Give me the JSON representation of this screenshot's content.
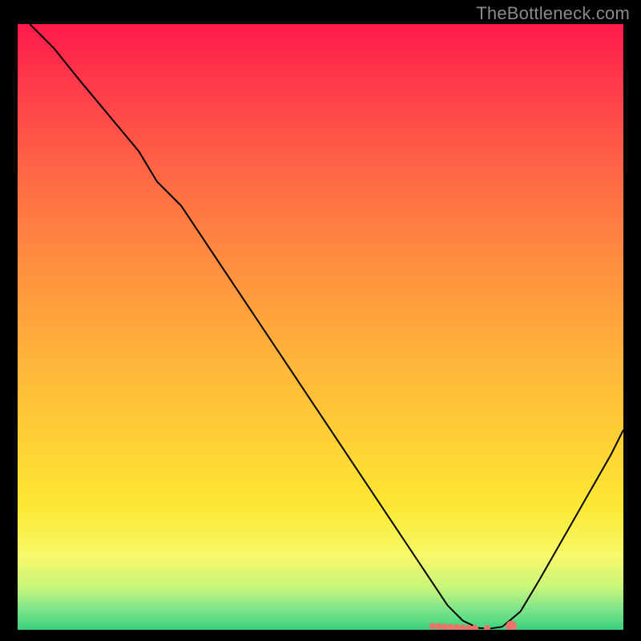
{
  "watermark": "TheBottleneck.com",
  "chart_data": {
    "type": "line",
    "title": "",
    "xlabel": "",
    "ylabel": "",
    "xlim": [
      0,
      100
    ],
    "ylim": [
      0,
      100
    ],
    "grid": false,
    "legend": false,
    "series": [
      {
        "name": "curve",
        "color": "#000000",
        "x": [
          2,
          6,
          10,
          15,
          20,
          23,
          27,
          31,
          35,
          39,
          43,
          47,
          51,
          55,
          59,
          63,
          67,
          71,
          73.5,
          76,
          78,
          80,
          83,
          86,
          90,
          94,
          98,
          100
        ],
        "values": [
          100,
          96,
          91,
          85,
          79,
          74,
          70,
          64,
          58,
          52,
          46,
          40,
          34,
          28,
          22,
          16,
          10,
          4,
          1.5,
          0.3,
          0.2,
          0.5,
          3,
          8,
          15,
          22,
          29,
          33
        ]
      }
    ],
    "markers": {
      "name": "highlight-points",
      "color": "#e9756a",
      "x": [
        68.5,
        69.5,
        70.5,
        71.5,
        72.5,
        73.5,
        74.5,
        75.5,
        77.5,
        81.5
      ],
      "values": [
        0.6,
        0.55,
        0.5,
        0.45,
        0.4,
        0.35,
        0.3,
        0.28,
        0.27,
        0.6
      ]
    },
    "background_gradient": {
      "stops": [
        {
          "offset": 0.0,
          "color": "#ff1a4b"
        },
        {
          "offset": 0.1,
          "color": "#ff3a4a"
        },
        {
          "offset": 0.25,
          "color": "#ff6845"
        },
        {
          "offset": 0.4,
          "color": "#ff8f3f"
        },
        {
          "offset": 0.55,
          "color": "#ffb33a"
        },
        {
          "offset": 0.7,
          "color": "#ffd335"
        },
        {
          "offset": 0.8,
          "color": "#fce934"
        },
        {
          "offset": 0.88,
          "color": "#f6f96a"
        },
        {
          "offset": 0.93,
          "color": "#c8f57a"
        },
        {
          "offset": 0.965,
          "color": "#7fe58a"
        },
        {
          "offset": 1.0,
          "color": "#38d27e"
        }
      ]
    }
  }
}
